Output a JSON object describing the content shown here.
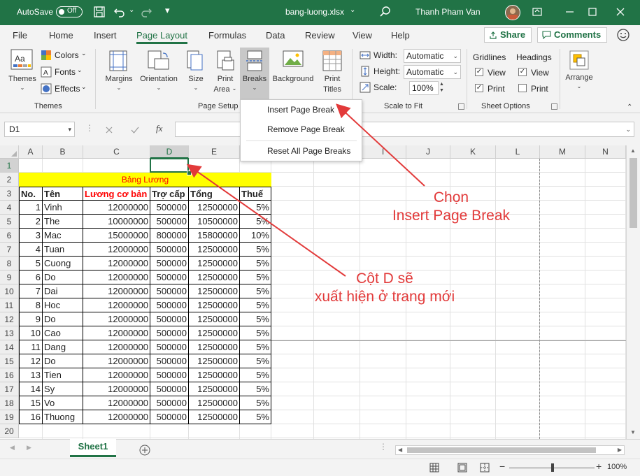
{
  "titlebar": {
    "autosave_label": "AutoSave",
    "autosave_state": "Off",
    "filename": "bang-luong.xlsx",
    "user_name": "Thanh Pham Van"
  },
  "menu": {
    "tabs": [
      "File",
      "Home",
      "Insert",
      "Page Layout",
      "Formulas",
      "Data",
      "Review",
      "View",
      "Help"
    ],
    "active_tab": "Page Layout",
    "share_label": "Share",
    "comments_label": "Comments"
  },
  "ribbon": {
    "themes": {
      "themes": "Themes",
      "colors": "Colors",
      "fonts": "Fonts",
      "effects": "Effects",
      "group": "Themes"
    },
    "page_setup": {
      "margins": "Margins",
      "orientation": "Orientation",
      "size": "Size",
      "print_area_1": "Print",
      "print_area_2": "Area",
      "breaks": "Breaks",
      "background": "Background",
      "print_titles_1": "Print",
      "print_titles_2": "Titles",
      "group": "Page Setup"
    },
    "scale_to_fit": {
      "width_label": "Width:",
      "width_value": "Automatic",
      "height_label": "Height:",
      "height_value": "Automatic",
      "scale_label": "Scale:",
      "scale_value": "100%",
      "group": "Scale to Fit"
    },
    "sheet_options": {
      "gridlines": "Gridlines",
      "headings": "Headings",
      "view": "View",
      "print": "Print",
      "group": "Sheet Options",
      "gridlines_view": true,
      "gridlines_print": true,
      "headings_view": true,
      "headings_print": false
    },
    "arrange": {
      "label": "Arrange"
    }
  },
  "breaks_menu": [
    "Insert Page Break",
    "Remove Page Break",
    "Reset All Page Breaks"
  ],
  "formula_bar": {
    "name_box": "D1",
    "fx": "fx",
    "content": ""
  },
  "columns": [
    "A",
    "B",
    "C",
    "D",
    "E",
    "F",
    "G",
    "H",
    "I",
    "J",
    "K",
    "L",
    "M",
    "N"
  ],
  "rows": [
    "1",
    "2",
    "3",
    "4",
    "5",
    "6",
    "7",
    "8",
    "9",
    "10",
    "11",
    "12",
    "13",
    "14",
    "15",
    "16",
    "17",
    "18",
    "19",
    "20"
  ],
  "sheet": {
    "title": "Bảng Lương",
    "headers": [
      "No.",
      "Tên",
      "Lương cơ bản",
      "Trợ cấp",
      "Tổng",
      "Thuế"
    ],
    "data": [
      [
        "1",
        "Vinh",
        "12000000",
        "500000",
        "12500000",
        "5%"
      ],
      [
        "2",
        "The",
        "10000000",
        "500000",
        "10500000",
        "5%"
      ],
      [
        "3",
        "Mac",
        "15000000",
        "800000",
        "15800000",
        "10%"
      ],
      [
        "4",
        "Tuan",
        "12000000",
        "500000",
        "12500000",
        "5%"
      ],
      [
        "5",
        "Cuong",
        "12000000",
        "500000",
        "12500000",
        "5%"
      ],
      [
        "6",
        "Do",
        "12000000",
        "500000",
        "12500000",
        "5%"
      ],
      [
        "7",
        "Dai",
        "12000000",
        "500000",
        "12500000",
        "5%"
      ],
      [
        "8",
        "Hoc",
        "12000000",
        "500000",
        "12500000",
        "5%"
      ],
      [
        "9",
        "Do",
        "12000000",
        "500000",
        "12500000",
        "5%"
      ],
      [
        "10",
        "Cao",
        "12000000",
        "500000",
        "12500000",
        "5%"
      ],
      [
        "11",
        "Dang",
        "12000000",
        "500000",
        "12500000",
        "5%"
      ],
      [
        "12",
        "Do",
        "12000000",
        "500000",
        "12500000",
        "5%"
      ],
      [
        "13",
        "Tien",
        "12000000",
        "500000",
        "12500000",
        "5%"
      ],
      [
        "14",
        "Sy",
        "12000000",
        "500000",
        "12500000",
        "5%"
      ],
      [
        "15",
        "Vo",
        "12000000",
        "500000",
        "12500000",
        "5%"
      ],
      [
        "16",
        "Thuong",
        "12000000",
        "500000",
        "12500000",
        "5%"
      ]
    ]
  },
  "sheet_tab": "Sheet1",
  "zoom": "100%",
  "annotations": {
    "choose_1": "Chọn",
    "choose_2": "Insert Page Break",
    "colD_1": "Cột D sẽ",
    "colD_2": "xuất hiện ở trang mới"
  },
  "colors": {
    "excel_green": "#217346",
    "title_fill": "#ffff00",
    "header_red": "#ff0000",
    "annotation": "#e23a3a"
  }
}
